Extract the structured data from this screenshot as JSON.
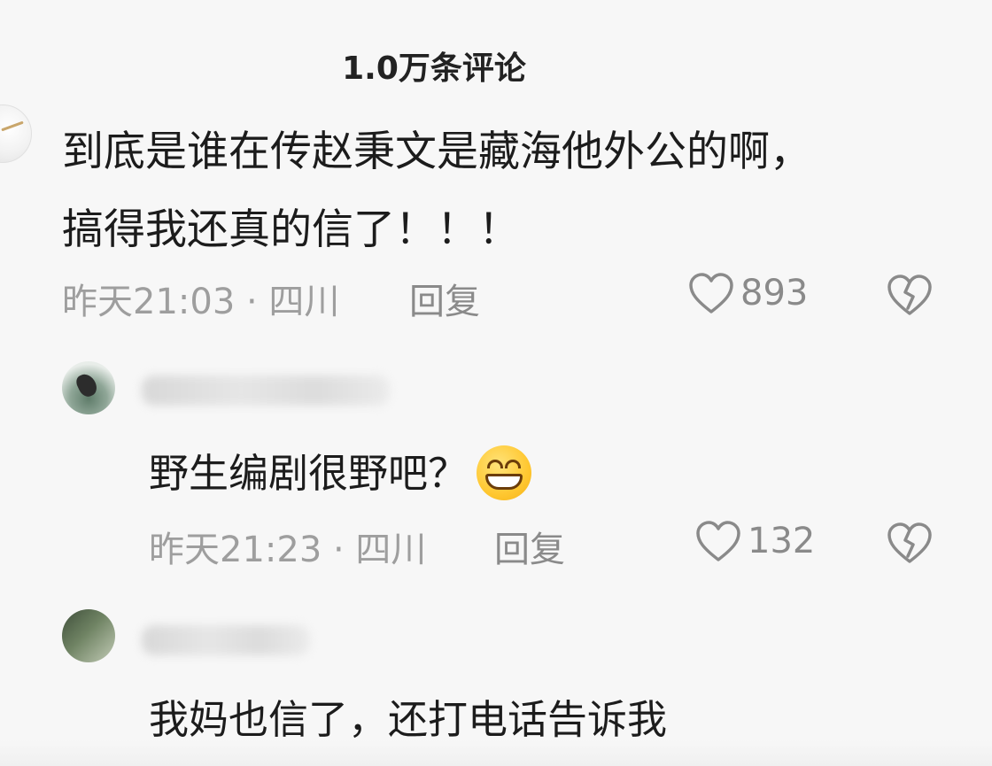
{
  "header": {
    "title": "1.0万条评论"
  },
  "comments": [
    {
      "text_line1": "到底是谁在传赵秉文是藏海他外公的啊，",
      "text_line2": "搞得我还真的信了！！！",
      "time_location": "昨天21:03 · 四川",
      "reply_label": "回复",
      "likes": "893"
    }
  ],
  "replies": [
    {
      "text": "野生编剧很野吧？",
      "emoji": "grinning-face",
      "time_location": "昨天21:23 · 四川",
      "reply_label": "回复",
      "likes": "132"
    },
    {
      "text": "我妈也信了，还打电话告诉我"
    }
  ],
  "colors": {
    "background": "#f7f7f7",
    "text": "#1c1c1c",
    "meta": "#9e9e9e"
  }
}
